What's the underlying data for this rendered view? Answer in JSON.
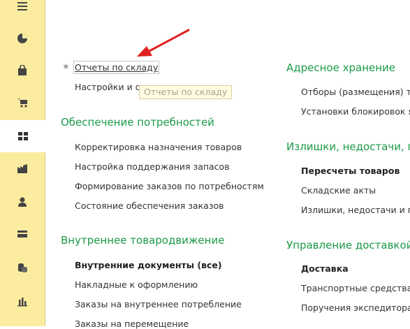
{
  "sidebar": {
    "items": [
      {
        "icon": "menu-icon",
        "active": false
      },
      {
        "icon": "pie-chart-icon",
        "active": false
      },
      {
        "icon": "shopping-bag-icon",
        "active": false
      },
      {
        "icon": "cart-icon",
        "active": false
      },
      {
        "icon": "grid-icon",
        "active": true
      },
      {
        "icon": "factory-icon",
        "active": false
      },
      {
        "icon": "user-icon",
        "active": false
      },
      {
        "icon": "card-icon",
        "active": false
      },
      {
        "icon": "coins-icon",
        "active": false
      },
      {
        "icon": "bar-chart-icon",
        "active": false
      }
    ]
  },
  "left_column": {
    "top_links": {
      "reports": "Отчеты по складу",
      "settings": "Настройки и справочники"
    },
    "tooltip": "Отчеты по складу",
    "needs_title": "Обеспечение потребностей",
    "needs_links": [
      "Корректировка назначения товаров",
      "Настройка поддержания запасов",
      "Формирование заказов по потребностям",
      "Состояние обеспечения заказов"
    ],
    "internal_title": "Внутреннее товародвижение",
    "internal_links": [
      "Внутренние документы (все)",
      "Накладные к оформлению",
      "Заказы на внутреннее потребление",
      "Заказы на перемещение"
    ]
  },
  "right_column": {
    "address_title": "Адресное хранение",
    "address_links": [
      "Отборы (размещения) то",
      "Установки блокировок я"
    ],
    "surplus_title": "Излишки, недостачи, п",
    "surplus_links": [
      "Пересчеты товаров",
      "Складские акты",
      "Излишки, недостачи и п"
    ],
    "delivery_title": "Управление доставкой",
    "delivery_links": [
      "Доставка",
      "Транспортные средства",
      "Поручения экспедитора"
    ]
  },
  "colors": {
    "sidebar_bg": "#fbeca0",
    "group_title": "#1b9a47",
    "arrow": "#e02020"
  }
}
